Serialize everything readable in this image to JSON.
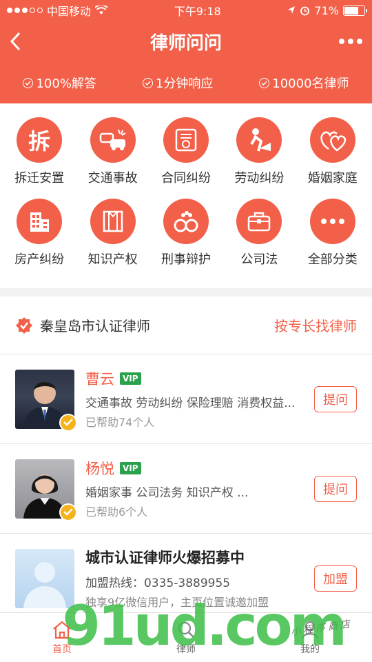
{
  "status_bar": {
    "carrier": "中国移动",
    "time": "下午9:18",
    "battery": "71%",
    "battery_level": 0.71
  },
  "nav": {
    "title": "律师问问"
  },
  "features": [
    {
      "label": "100%解答"
    },
    {
      "label": "1分钟响应"
    },
    {
      "label": "10000名律师"
    }
  ],
  "categories": [
    {
      "label": "拆迁安置",
      "icon": "demolition-icon",
      "glyph": "拆"
    },
    {
      "label": "交通事故",
      "icon": "car-accident-icon"
    },
    {
      "label": "合同纠纷",
      "icon": "contract-icon"
    },
    {
      "label": "劳动纠纷",
      "icon": "worker-icon"
    },
    {
      "label": "婚姻家庭",
      "icon": "hearts-icon"
    },
    {
      "label": "房产纠纷",
      "icon": "building-icon"
    },
    {
      "label": "知识产权",
      "icon": "book-icon"
    },
    {
      "label": "刑事辩护",
      "icon": "handcuffs-icon"
    },
    {
      "label": "公司法",
      "icon": "briefcase-icon"
    },
    {
      "label": "全部分类",
      "icon": "more-icon"
    }
  ],
  "lawyers_section": {
    "title": "秦皇岛市认证律师",
    "link": "按专长找律师"
  },
  "lawyers": [
    {
      "name": "曹云",
      "badge": "VIP",
      "specialty": "交通事故 劳动纠纷 保险理赔 消费权益...",
      "helped": "已帮助74个人",
      "button": "提问"
    },
    {
      "name": "杨悦",
      "badge": "VIP",
      "specialty": "婚姻家事 公司法务 知识产权 ...",
      "helped": "已帮助6个人",
      "button": "提问"
    }
  ],
  "recruit": {
    "title": "城市认证律师火爆招募中",
    "hotline": "加盟热线：0335-3889955",
    "desc": "独享9亿微信用户，主页位置诚邀加盟",
    "button": "加盟"
  },
  "tabbar": [
    {
      "label": "首页",
      "icon": "home-icon",
      "active": true
    },
    {
      "label": "律师",
      "icon": "lawyer-icon",
      "active": false
    },
    {
      "label": "我的",
      "icon": "user-icon",
      "active": false
    }
  ],
  "watermark": {
    "text": "91ud.com",
    "sub": "小程序商店"
  },
  "colors": {
    "accent": "#f2604a",
    "vip": "#2aa14b",
    "verified": "#f5b21a"
  }
}
